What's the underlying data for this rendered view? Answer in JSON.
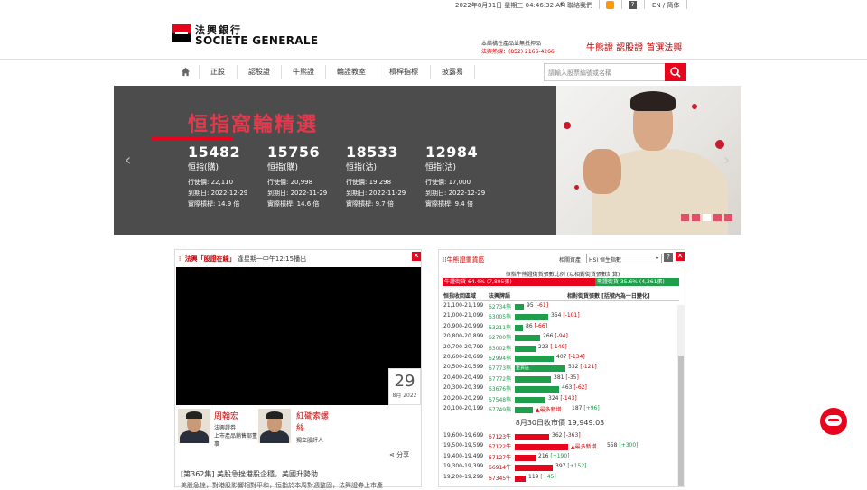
{
  "util": {
    "datetime": "2022年8月31日 星期三 04:46:32 AM",
    "contact": "聯絡我們",
    "lang": "EN / 简体"
  },
  "header": {
    "logo_cn": "法興銀行",
    "logo_en": "SOCIETE GENERALE",
    "hotline_line1": "本結構性產品並無抵押品",
    "hotline_line2": "法興熱線：(852) 2166-4266",
    "tagline": "牛熊證 認股證 首選法興"
  },
  "nav": {
    "items": [
      "正股",
      "認股證",
      "牛熊證",
      "輪證教室",
      "槓桿指標",
      "披露易"
    ],
    "search_placeholder": "請輸入股票編號或名稱"
  },
  "hero": {
    "title": "恒指窩輪精選",
    "cards": [
      {
        "number": "15482",
        "type": "恒指(購)",
        "strike": "行使價: 22,110",
        "expiry": "到期日: 2022-12-29",
        "leverage": "實際槓桿: 14.9 倍"
      },
      {
        "number": "15756",
        "type": "恒指(購)",
        "strike": "行使價: 20,998",
        "expiry": "到期日: 2022-11-29",
        "leverage": "實際槓桿: 14.6 倍"
      },
      {
        "number": "18533",
        "type": "恒指(沽)",
        "strike": "行使價: 19,298",
        "expiry": "到期日: 2022-11-29",
        "leverage": "實際槓桿: 9.7 倍"
      },
      {
        "number": "12984",
        "type": "恒指(沽)",
        "strike": "行使價: 17,000",
        "expiry": "到期日: 2022-12-29",
        "leverage": "實際槓桿: 9.4 倍"
      }
    ]
  },
  "left_panel": {
    "title_prefix": "法興「股證在線」",
    "title_suffix": "逢星期一中午12:15播出",
    "date_day": "29",
    "date_month": "8月 2022",
    "host1_name": "周翰宏",
    "host1_org": "法興證券",
    "host1_role": "上市產品銷售部董事",
    "host2_name": "紅磡索螺絲",
    "host2_role": "獨立股評人",
    "share": "分享",
    "episode": "[第362集] 美股急挫港股企穩，美國升勢助",
    "episode_desc": "美股急挫，對港股影響相對平和，恒指於本周對週整固，法興證券上市產"
  },
  "right_panel": {
    "title": "牛熊證重貨區",
    "asset_label": "相關資產",
    "asset_value": "HSI 恒生指數",
    "ratio_title": "恒指牛熊證街貨張數比例 (以相對街貨張數計算)",
    "bull_label": "牛證街貨 64.4% (7,895張)",
    "bear_label": "熊證街貨 35.6% (4,361張)",
    "bull_pct": 64.4,
    "col1": "恒指收回區域",
    "col2": "法興牌語",
    "col3": "相對街貨張數 [括號內為一日變化]",
    "close_label": "8月30日收市價 19,949.03",
    "heavy_label": "重貨區",
    "most_new_label": "最多新增",
    "bear_rows": [
      {
        "range": "21,100-21,199",
        "code": "62734熊",
        "value": 95,
        "change": "-61"
      },
      {
        "range": "21,000-21,099",
        "code": "63005熊",
        "value": 354,
        "change": "-101"
      },
      {
        "range": "20,900-20,999",
        "code": "63211熊",
        "value": 86,
        "change": "-66"
      },
      {
        "range": "20,800-20,899",
        "code": "62700熊",
        "value": 266,
        "change": "-94"
      },
      {
        "range": "20,700-20,799",
        "code": "63002熊",
        "value": 223,
        "change": "-149"
      },
      {
        "range": "20,600-20,699",
        "code": "62994熊",
        "value": 407,
        "change": "-134"
      },
      {
        "range": "20,500-20,599",
        "code": "67773熊",
        "value": 532,
        "change": "-121",
        "heavy": true
      },
      {
        "range": "20,400-20,499",
        "code": "67772熊",
        "value": 381,
        "change": "-35"
      },
      {
        "range": "20,300-20,399",
        "code": "63676熊",
        "value": 463,
        "change": "-62"
      },
      {
        "range": "20,200-20,299",
        "code": "67548熊",
        "value": 324,
        "change": "-143"
      },
      {
        "range": "20,100-20,199",
        "code": "67749熊",
        "value": 187,
        "change": "+96",
        "most_new": true
      }
    ],
    "bull_rows": [
      {
        "range": "19,600-19,699",
        "code": "67123牛",
        "value": 362,
        "change": "-363"
      },
      {
        "range": "19,500-19,599",
        "code": "67122牛",
        "value": 558,
        "change": "+300",
        "most_new": true
      },
      {
        "range": "19,400-19,499",
        "code": "67127牛",
        "value": 216,
        "change": "+190"
      },
      {
        "range": "19,300-19,399",
        "code": "66914牛",
        "value": 397,
        "change": "+152"
      },
      {
        "range": "19,200-19,299",
        "code": "67345牛",
        "value": 119,
        "change": "+45"
      }
    ]
  }
}
